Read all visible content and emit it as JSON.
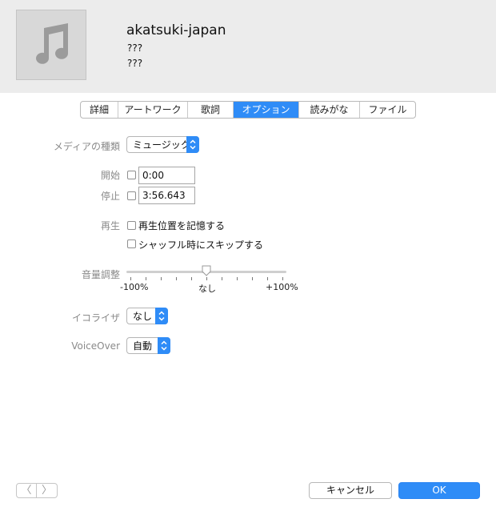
{
  "header": {
    "title": "akatsuki-japan",
    "artist": "???",
    "album": "???",
    "artwork_icon": "music-note-icon"
  },
  "tabs": [
    {
      "label": "詳細",
      "active": false
    },
    {
      "label": "アートワーク",
      "active": false
    },
    {
      "label": "歌詞",
      "active": false
    },
    {
      "label": "オプション",
      "active": true
    },
    {
      "label": "読みがな",
      "active": false
    },
    {
      "label": "ファイル",
      "active": false
    }
  ],
  "options": {
    "media_kind_label": "メディアの種類",
    "media_kind_value": "ミュージック",
    "start_label": "開始",
    "start_value": "0:00",
    "start_checked": false,
    "stop_label": "停止",
    "stop_value": "3:56.643",
    "stop_checked": false,
    "playback_label": "再生",
    "remember_position_label": "再生位置を記憶する",
    "remember_position_checked": false,
    "skip_shuffle_label": "シャッフル時にスキップする",
    "skip_shuffle_checked": false,
    "volume_label": "音量調整",
    "volume_min_label": "-100%",
    "volume_mid_label": "なし",
    "volume_max_label": "+100%",
    "volume_value_percent": 0,
    "equalizer_label": "イコライザ",
    "equalizer_value": "なし",
    "voiceover_label": "VoiceOver",
    "voiceover_value": "自動"
  },
  "footer": {
    "prev_icon": "chevron-left-icon",
    "next_icon": "chevron-right-icon",
    "prev_glyph": "〈",
    "next_glyph": "〉",
    "cancel_label": "キャンセル",
    "ok_label": "OK"
  },
  "colors": {
    "accent": "#2f8cf7",
    "header_bg": "#ececec",
    "label_gray": "#8a8a8a"
  }
}
